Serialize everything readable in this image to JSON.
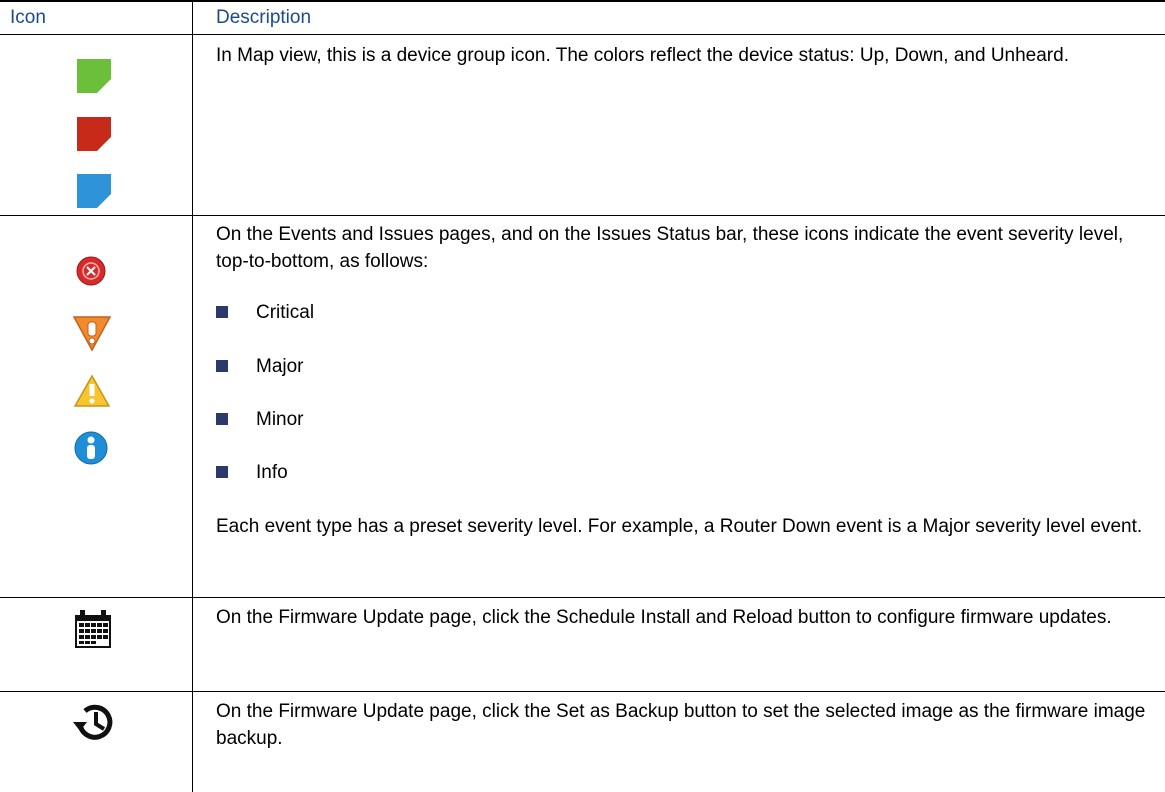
{
  "table": {
    "headers": {
      "icon": "Icon",
      "description": "Description"
    },
    "rows": [
      {
        "description": "In Map view, this is a device group icon. The colors reflect the device status: Up, Down, and Unheard.",
        "icons": [
          "device-group-up-icon",
          "device-group-down-icon",
          "device-group-unheard-icon"
        ],
        "colors": {
          "up": "#6cbf3a",
          "down": "#c82a1a",
          "unheard": "#2f93d9"
        }
      },
      {
        "description": "On the Events and Issues pages, and on the Issues Status bar, these icons indicate the event severity level, top-to-bottom, as follows:",
        "bullets": [
          "Critical",
          "Major",
          "Minor",
          "Info"
        ],
        "note": "Each event type has a preset severity level. For example, a Router Down event is a Major severity level event.",
        "icons": [
          "critical-severity-icon",
          "major-severity-icon",
          "minor-severity-icon",
          "info-severity-icon"
        ]
      },
      {
        "description": "On the Firmware Update page, click the Schedule Install and Reload button to configure firmware updates.",
        "icons": [
          "calendar-icon"
        ]
      },
      {
        "description": "On the Firmware Update page, click the Set as Backup button to set the selected image as the firmware image backup.",
        "icons": [
          "history-backup-icon"
        ]
      }
    ]
  }
}
